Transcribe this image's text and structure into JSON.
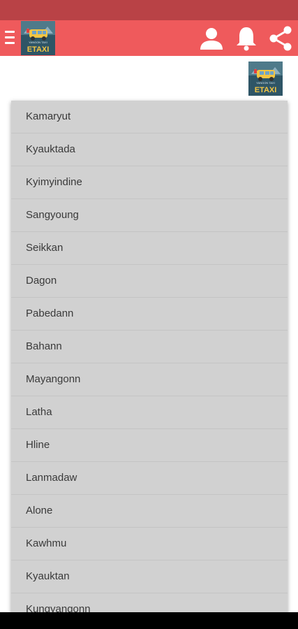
{
  "logo": {
    "brand_text": "ETAXI",
    "tagline": "YANGON TAXI"
  },
  "header": {
    "menu_icon": "hamburger-icon",
    "profile_icon": "person-icon",
    "notifications_icon": "bell-icon",
    "share_icon": "share-icon"
  },
  "dropdown": {
    "items": [
      "Kamaryut",
      "Kyauktada",
      "Kyimyindine",
      "Sangyoung",
      "Seikkan",
      "Dagon",
      "Pabedann",
      "Bahann",
      "Mayangonn",
      "Latha",
      "Hline",
      "Lanmadaw",
      "Alone",
      "Kawhmu",
      "Kyauktan",
      "Kungyangonn"
    ]
  },
  "colors": {
    "status_bar": "#b94246",
    "app_bar": "#ef5a5c",
    "dropdown_bg": "#d1d1d1",
    "item_text": "#3a3a3a",
    "logo_bg": "#2e5566",
    "logo_text": "#f4c542"
  }
}
